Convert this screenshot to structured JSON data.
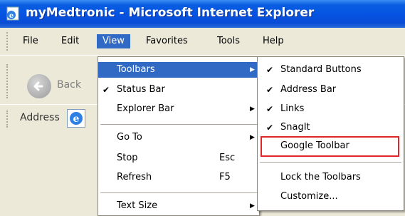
{
  "window": {
    "title": "myMedtronic - Microsoft Internet Explorer",
    "icon": "ie-page-icon"
  },
  "menubar": {
    "items": [
      "File",
      "Edit",
      "View",
      "Favorites",
      "Tools",
      "Help"
    ],
    "active": "View"
  },
  "toolbar": {
    "back_label": "Back",
    "back_icon": "back-arrow-icon"
  },
  "addressbar": {
    "label": "Address",
    "icon": "ie-icon"
  },
  "view_menu": {
    "items": [
      {
        "label": "Toolbars",
        "submenu": true,
        "highlighted": true,
        "checked": false,
        "shortcut": ""
      },
      {
        "label": "Status Bar",
        "submenu": false,
        "highlighted": false,
        "checked": true,
        "shortcut": ""
      },
      {
        "label": "Explorer Bar",
        "submenu": true,
        "highlighted": false,
        "checked": false,
        "shortcut": ""
      },
      {
        "label": "Go To",
        "submenu": true,
        "highlighted": false,
        "checked": false,
        "shortcut": ""
      },
      {
        "label": "Stop",
        "submenu": false,
        "highlighted": false,
        "checked": false,
        "shortcut": "Esc"
      },
      {
        "label": "Refresh",
        "submenu": false,
        "highlighted": false,
        "checked": false,
        "shortcut": "F5"
      },
      {
        "label": "Text Size",
        "submenu": true,
        "highlighted": false,
        "checked": false,
        "shortcut": ""
      }
    ]
  },
  "toolbars_submenu": {
    "items": [
      {
        "label": "Standard Buttons",
        "checked": true
      },
      {
        "label": "Address Bar",
        "checked": true
      },
      {
        "label": "Links",
        "checked": true
      },
      {
        "label": "SnagIt",
        "checked": true
      },
      {
        "label": "Google Toolbar",
        "checked": false,
        "emphasized": true
      },
      {
        "label": "Lock the Toolbars",
        "checked": false
      },
      {
        "label": "Customize...",
        "checked": false
      }
    ]
  },
  "colors": {
    "titlebar": "#0554e3",
    "menu_highlight": "#316ac5",
    "emphasis_box": "#e0262b"
  }
}
